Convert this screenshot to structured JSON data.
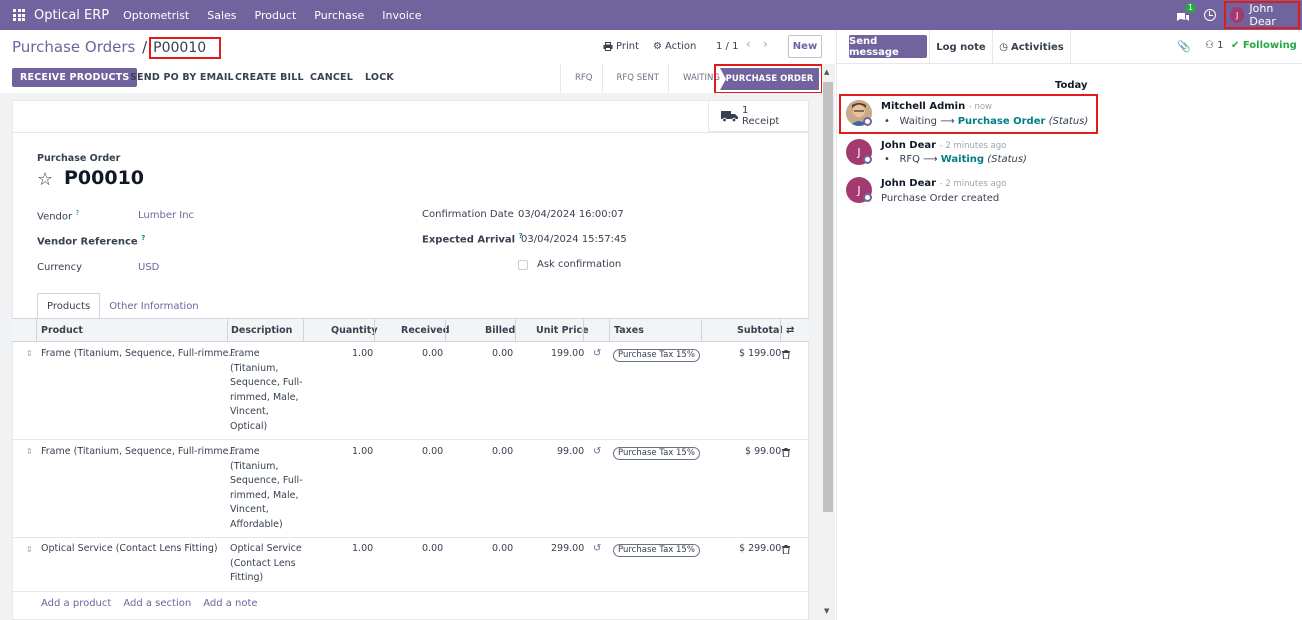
{
  "topbar": {
    "app_name": "Optical ERP",
    "menu": [
      "Optometrist",
      "Sales",
      "Product",
      "Purchase",
      "Invoice"
    ],
    "chat_badge": "1",
    "user_initial": "J",
    "user_name": "John Dear"
  },
  "control": {
    "breadcrumb_parent": "Purchase Orders",
    "breadcrumb_sep": "/",
    "breadcrumb_current": "P00010",
    "print_label": "Print",
    "action_label": "Action",
    "pager": "1 / 1",
    "new_label": "New"
  },
  "statusbar": {
    "buttons": [
      "RECEIVE PRODUCTS",
      "SEND PO BY EMAIL",
      "CREATE BILL",
      "CANCEL",
      "LOCK"
    ],
    "stages": [
      "RFQ",
      "RFQ SENT",
      "WAITING"
    ],
    "current_stage": "PURCHASE ORDER"
  },
  "smart_button": {
    "count": "1",
    "label": "Receipt"
  },
  "form": {
    "doc_type": "Purchase Order",
    "name": "P00010",
    "vendor_label": "Vendor",
    "vendor_value": "Lumber Inc",
    "vendor_ref_label": "Vendor Reference",
    "currency_label": "Currency",
    "currency_value": "USD",
    "confirmation_label": "Confirmation Date",
    "confirmation_value": "03/04/2024 16:00:07",
    "expected_label": "Expected Arrival",
    "expected_value": "03/04/2024 15:57:45",
    "ask_confirmation": "Ask confirmation",
    "help_mark": "?"
  },
  "tabs": [
    "Products",
    "Other Information"
  ],
  "table": {
    "headers": [
      "Product",
      "Description",
      "Quantity",
      "Received",
      "Billed",
      "Unit Price",
      "Taxes",
      "Subtotal"
    ],
    "rows": [
      {
        "product": "Frame (Titanium, Sequence, Full-rimme…",
        "description": [
          "Frame",
          "(Titanium,",
          "Sequence, Full-",
          "rimmed, Male,",
          "Vincent,",
          "Optical)"
        ],
        "quantity": "1.00",
        "received": "0.00",
        "billed": "0.00",
        "unit_price": "199.00",
        "tax": "Purchase Tax 15%",
        "subtotal": "$ 199.00"
      },
      {
        "product": "Frame (Titanium, Sequence, Full-rimme…",
        "description": [
          "Frame",
          "(Titanium,",
          "Sequence, Full-",
          "rimmed, Male,",
          "Vincent,",
          "Affordable)"
        ],
        "quantity": "1.00",
        "received": "0.00",
        "billed": "0.00",
        "unit_price": "99.00",
        "tax": "Purchase Tax 15%",
        "subtotal": "$ 99.00"
      },
      {
        "product": "Optical Service (Contact Lens Fitting)",
        "description": [
          "Optical Service",
          "(Contact Lens",
          "Fitting)"
        ],
        "quantity": "1.00",
        "received": "0.00",
        "billed": "0.00",
        "unit_price": "299.00",
        "tax": "Purchase Tax 15%",
        "subtotal": "$ 299.00"
      }
    ],
    "add_links": [
      "Add a product",
      "Add a section",
      "Add a note"
    ]
  },
  "chatter": {
    "send_message": "Send message",
    "log_note": "Log note",
    "activities": "Activities",
    "follower_count": "1",
    "following": "Following",
    "date_header": "Today",
    "messages": [
      {
        "author": "Mitchell Admin",
        "when": "- now",
        "from": "Waiting",
        "to": "Purchase Order",
        "field": "(Status)"
      },
      {
        "author": "John Dear",
        "initial": "J",
        "when": "- 2 minutes ago",
        "from": "RFQ",
        "to": "Waiting",
        "field": "(Status)"
      },
      {
        "author": "John Dear",
        "initial": "J",
        "when": "- 2 minutes ago",
        "text": "Purchase Order created"
      }
    ]
  }
}
